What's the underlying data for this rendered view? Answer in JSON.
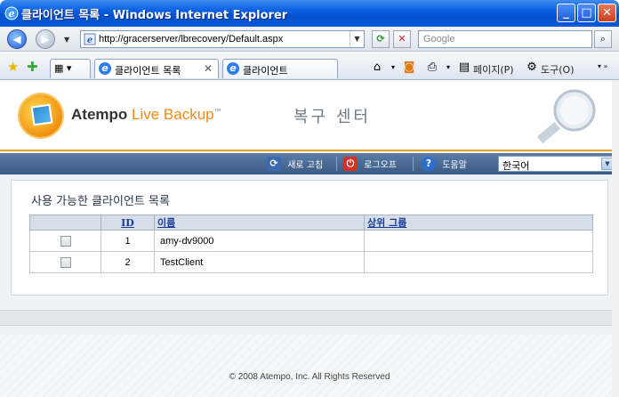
{
  "window": {
    "title": "클라이언트 목록 - Windows Internet Explorer",
    "buttons": {
      "minimize": "_",
      "maximize": "□",
      "close": "✕"
    }
  },
  "address_bar": {
    "url": "http://gracerserver/lbrecovery/Default.aspx",
    "search_placeholder": "Google"
  },
  "tabs": [
    {
      "label": "클라이언트 목록",
      "close": "✕",
      "active": true
    },
    {
      "label": "클라이언트",
      "active": false
    }
  ],
  "command_bar": {
    "page": "페이지(P)",
    "tools": "도구(O)"
  },
  "header": {
    "brand_strong": "Atempo",
    "brand_light": "Live Backup",
    "brand_tm": "™",
    "section_title": "복구 센터"
  },
  "toolbar": {
    "refresh": "새로 고침",
    "logout": "로그오프",
    "help": "도움말",
    "language": "한국어"
  },
  "panel": {
    "title": "사용 가능한 클라이언트 목록",
    "columns": {
      "id": "ID",
      "name": "이름",
      "group": "상위 그룹"
    },
    "rows": [
      {
        "id": "1",
        "name": "amy-dv9000",
        "group": ""
      },
      {
        "id": "2",
        "name": "TestClient",
        "group": ""
      }
    ]
  },
  "footer": {
    "copyright": "© 2008 Atempo, Inc. All Rights Reserved"
  },
  "colors": {
    "title_bar": "#0b5fe0",
    "brand_orange": "#f08a10",
    "toolbar": "#4a6b96"
  }
}
